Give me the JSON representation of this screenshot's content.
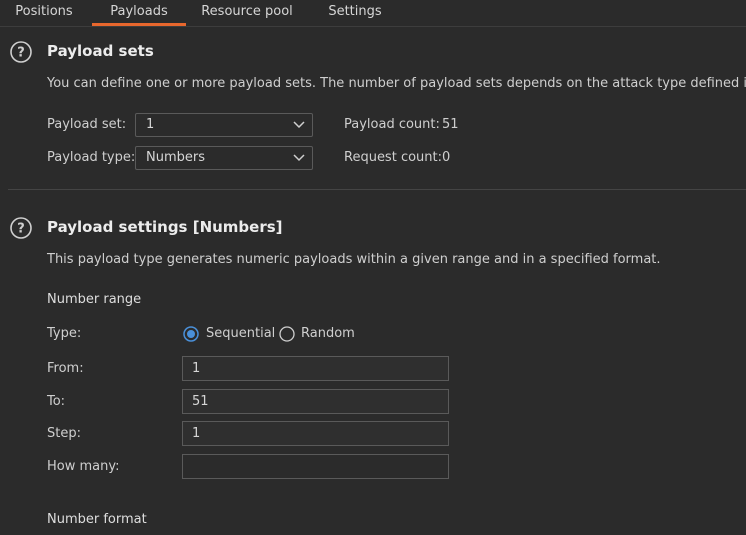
{
  "tabs": [
    {
      "label": "Positions",
      "active": false
    },
    {
      "label": "Payloads",
      "active": true
    },
    {
      "label": "Resource pool",
      "active": false
    },
    {
      "label": "Settings",
      "active": false
    }
  ],
  "payload_sets": {
    "title": "Payload sets",
    "description": "You can define one or more payload sets. The number of payload sets depends on the attack type defined in the P",
    "payload_set_label": "Payload set:",
    "payload_set_value": "1",
    "payload_type_label": "Payload type:",
    "payload_type_value": "Numbers",
    "payload_count_label": "Payload count:",
    "payload_count_value": "51",
    "request_count_label": "Request count:",
    "request_count_value": "0"
  },
  "payload_settings": {
    "title": "Payload settings [Numbers]",
    "description": "This payload type generates numeric payloads within a given range and in a specified format.",
    "number_range_heading": "Number range",
    "type_label": "Type:",
    "type_options": [
      "Sequential",
      "Random"
    ],
    "type_selected": "Sequential",
    "from_label": "From:",
    "from_value": "1",
    "to_label": "To:",
    "to_value": "51",
    "step_label": "Step:",
    "step_value": "1",
    "how_many_label": "How many:",
    "how_many_value": "",
    "number_format_heading": "Number format"
  },
  "colors": {
    "background": "#2b2b2b",
    "accent": "#e8672d",
    "radio_selected": "#4a90d9"
  },
  "icons": [
    "help-icon",
    "chevron-down-icon",
    "radio-selected-icon",
    "radio-unselected-icon"
  ]
}
